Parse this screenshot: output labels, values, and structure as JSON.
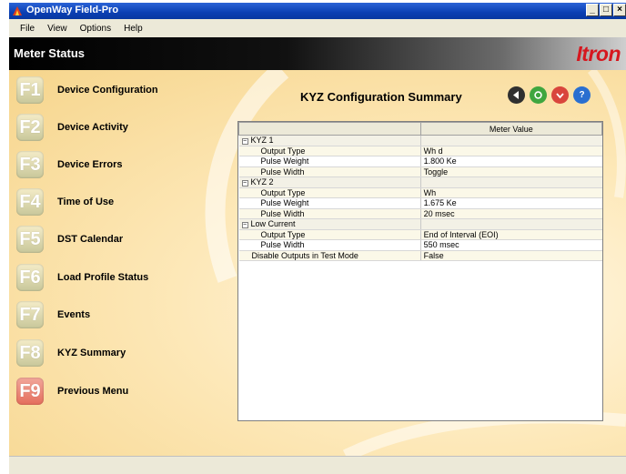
{
  "window": {
    "title": "OpenWay Field-Pro",
    "controls": [
      "_",
      "□",
      "×"
    ]
  },
  "menu": [
    "File",
    "View",
    "Options",
    "Help"
  ],
  "header": {
    "title": "Meter Status",
    "logo": "Itron"
  },
  "fkeys": [
    {
      "key": "F1",
      "label": "Device Configuration"
    },
    {
      "key": "F2",
      "label": "Device Activity"
    },
    {
      "key": "F3",
      "label": "Device Errors"
    },
    {
      "key": "F4",
      "label": "Time of Use"
    },
    {
      "key": "F5",
      "label": "DST Calendar"
    },
    {
      "key": "F6",
      "label": "Load Profile Status"
    },
    {
      "key": "F7",
      "label": "Events"
    },
    {
      "key": "F8",
      "label": "KYZ Summary"
    },
    {
      "key": "F9",
      "label": "Previous Menu"
    }
  ],
  "summary": {
    "title": "KYZ Configuration Summary",
    "icons": [
      {
        "name": "back-icon",
        "color": "#2f2f2f"
      },
      {
        "name": "refresh-icon",
        "color": "#3fa63f"
      },
      {
        "name": "stop-icon",
        "color": "#d9453c"
      },
      {
        "name": "help-icon",
        "color": "#2a6fd0"
      }
    ]
  },
  "grid": {
    "header": [
      "",
      "Meter Value"
    ],
    "rows": [
      {
        "type": "group",
        "name": "KYZ 1",
        "value": ""
      },
      {
        "type": "item",
        "name": "Output Type",
        "value": "Wh d"
      },
      {
        "type": "item",
        "name": "Pulse Weight",
        "value": "1.800 Ke"
      },
      {
        "type": "item",
        "name": "Pulse Width",
        "value": "Toggle"
      },
      {
        "type": "group",
        "name": "KYZ 2",
        "value": ""
      },
      {
        "type": "item",
        "name": "Output Type",
        "value": "Wh"
      },
      {
        "type": "item",
        "name": "Pulse Weight",
        "value": "1.675 Ke"
      },
      {
        "type": "item",
        "name": "Pulse Width",
        "value": "20 msec"
      },
      {
        "type": "group",
        "name": "Low Current",
        "value": ""
      },
      {
        "type": "item",
        "name": "Output Type",
        "value": "End of Interval (EOI)"
      },
      {
        "type": "item",
        "name": "Pulse Width",
        "value": "550 msec"
      },
      {
        "type": "plain",
        "name": "Disable Outputs in Test Mode",
        "value": "False"
      }
    ]
  }
}
